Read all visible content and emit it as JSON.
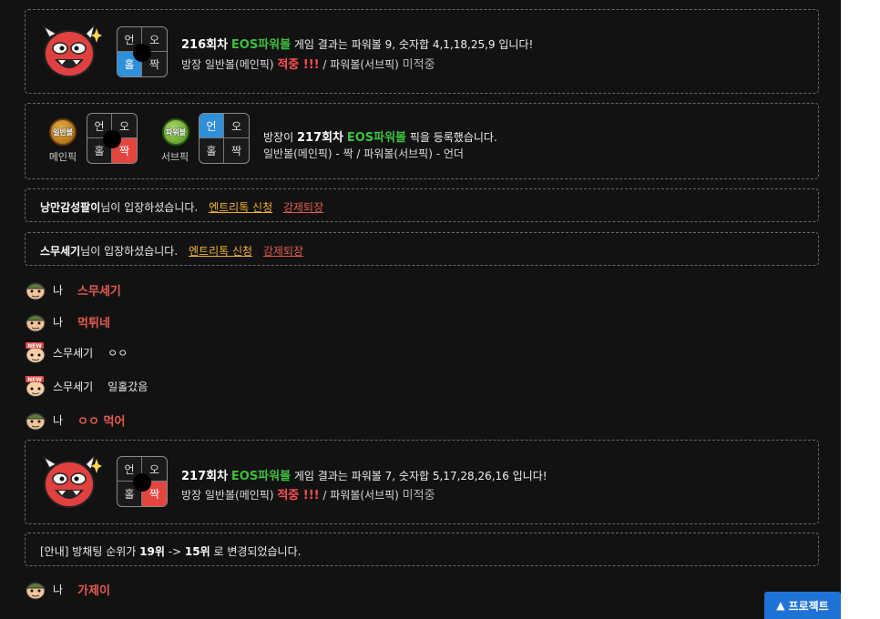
{
  "results": [
    {
      "round": "216회차",
      "game": "EOS파워볼",
      "text_pre": " 게임 결과는 파워볼 9, 숫자합 4,1,18,25,9 입니다!",
      "grid": {
        "tl": "언",
        "tr": "오",
        "bl": "홀",
        "br": "짝"
      },
      "highlight": {
        "bl": "#2f8fd8"
      },
      "host_label": "방장 일반볼(메인픽)",
      "main_status": "적중 !!!",
      "sub_label": " / 파워볼(서브픽)",
      "sub_status": "미적중"
    },
    {
      "round": "217회차",
      "game": "EOS파워볼",
      "text_pre": " 게임 결과는 파워볼 7, 숫자합 5,17,28,26,16 입니다!",
      "grid": {
        "tl": "언",
        "tr": "오",
        "bl": "홀",
        "br": "짝"
      },
      "highlight": {
        "br": "#e2463f"
      },
      "host_label": "방장 일반볼(메인픽)",
      "main_status": "적중 !!!",
      "sub_label": " / 파워볼(서브픽)",
      "sub_status": "미적중"
    }
  ],
  "pick": {
    "main_badge": "일반볼",
    "main_caption": "메인픽",
    "main_grid": {
      "tl": "언",
      "tr": "오",
      "bl": "홀",
      "br": "짝"
    },
    "sub_badge": "파워볼",
    "sub_caption": "서브픽",
    "sub_grid": {
      "tl": "언",
      "tr": "오",
      "bl": "홀",
      "br": "짝"
    },
    "line1_pre": "방장이 ",
    "line1_round": "217회차",
    "line1_game": "EOS파워볼",
    "line1_post": " 픽을 등록했습니다.",
    "line2": "일반볼(메인픽) - 짝 / 파워볼(서브픽) - 언더"
  },
  "entries": [
    {
      "nick": "낭만감성팔이",
      "text": "님이 입장하셨습니다.",
      "apply": "엔트리톡 신청",
      "kick": "강제퇴장"
    },
    {
      "nick": "스무세기",
      "text": "님이 입장하셨습니다.",
      "apply": "엔트리톡 신청",
      "kick": "강제퇴장"
    }
  ],
  "messages": [
    {
      "who": "나",
      "text": "스무세기"
    },
    {
      "who": "나",
      "text": "먹튀네"
    },
    {
      "who": "스무세기",
      "text": "ㅇㅇ"
    },
    {
      "who": "스무세기",
      "text": "일홀갔음"
    },
    {
      "who": "나",
      "text": "ㅇㅇ 먹어"
    },
    {
      "who": "나",
      "text": "가제이"
    }
  ],
  "avatar_new": "NEW",
  "rank_notice": {
    "pre": "[안내] 방채팅 순위가 ",
    "from": "19위",
    "arrow": " -> ",
    "to": "15위",
    "post": " 로 변경되었습니다."
  },
  "project_button": "프로젝트"
}
